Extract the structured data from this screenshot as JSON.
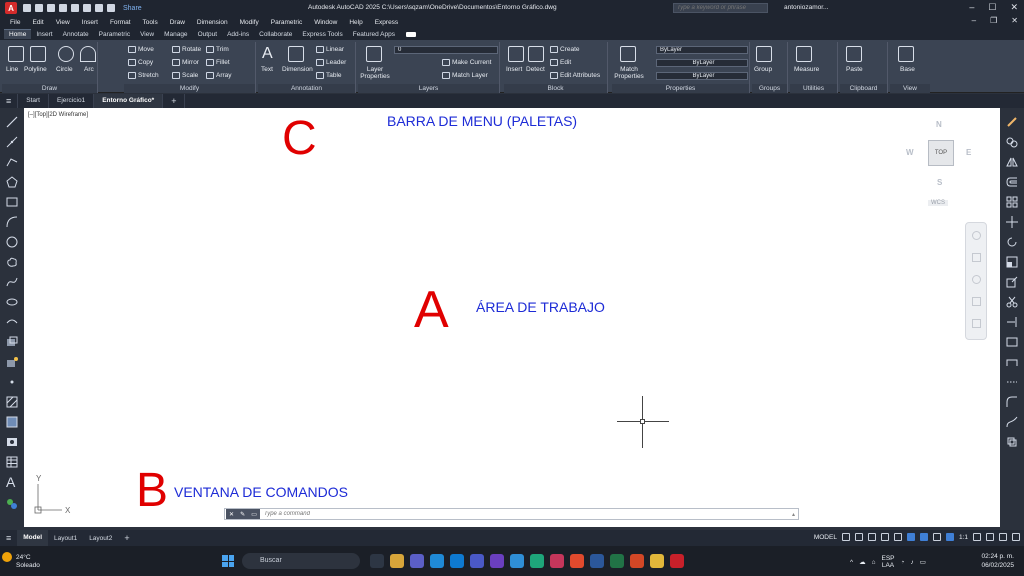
{
  "titlebar": {
    "app_logo": "A",
    "share_label": "Share",
    "title": "Autodesk AutoCAD 2025   C:\\Users\\sqzam\\OneDrive\\Documentos\\Entorno Gráfico.dwg",
    "search_placeholder": "Type a keyword or phrase",
    "user": "antoniozamor...",
    "window_controls": [
      "–",
      "☐",
      "✕"
    ]
  },
  "menubar": {
    "items": [
      "File",
      "Edit",
      "View",
      "Insert",
      "Format",
      "Tools",
      "Draw",
      "Dimension",
      "Modify",
      "Parametric",
      "Window",
      "Help",
      "Express"
    ]
  },
  "ribbon_tabs": {
    "items": [
      "Home",
      "Insert",
      "Annotate",
      "Parametric",
      "View",
      "Manage",
      "Output",
      "Add-ins",
      "Collaborate",
      "Express Tools",
      "Featured Apps"
    ],
    "active": "Home"
  },
  "ribbon": {
    "draw": {
      "title": "Draw",
      "line": "Line",
      "polyline": "Polyline",
      "circle": "Circle",
      "arc": "Arc"
    },
    "modify": {
      "title": "Modify",
      "move": "Move",
      "rotate": "Rotate",
      "trim": "Trim",
      "copy": "Copy",
      "mirror": "Mirror",
      "fillet": "Fillet",
      "stretch": "Stretch",
      "scale": "Scale",
      "array": "Array"
    },
    "annotation": {
      "title": "Annotation",
      "text": "Text",
      "dimension": "Dimension",
      "linear": "Linear",
      "leader": "Leader",
      "table": "Table"
    },
    "layers": {
      "title": "Layers",
      "layer_properties": "Layer Properties",
      "layer_value": "0",
      "make_current": "Make Current",
      "match_layer": "Match Layer"
    },
    "block": {
      "title": "Block",
      "insert": "Insert",
      "detect": "Detect",
      "create": "Create",
      "edit": "Edit",
      "edit_attributes": "Edit Attributes"
    },
    "properties": {
      "title": "Properties",
      "match_properties": "Match Properties",
      "color": "ByLayer",
      "linetype": "ByLayer",
      "lineweight": "ByLayer"
    },
    "groups": {
      "title": "Groups",
      "group": "Group"
    },
    "utilities": {
      "title": "Utilities",
      "measure": "Measure"
    },
    "clipboard": {
      "title": "Clipboard",
      "paste": "Paste"
    },
    "view": {
      "title": "View",
      "base": "Base"
    }
  },
  "file_tabs": {
    "items": [
      "Start",
      "Ejercicio1",
      "Entorno Gráfico*"
    ],
    "active": "Entorno Gráfico*"
  },
  "workarea": {
    "viewport_label": "[–][Top][2D Wireframe]",
    "letter_c": "C",
    "label_c": "BARRA DE MENU (PALETAS)",
    "letter_a": "A",
    "label_a": "ÁREA DE TRABAJO",
    "letter_b": "B",
    "label_b": "VENTANA DE COMANDOS",
    "ucs_x": "X",
    "ucs_y": "Y"
  },
  "viewcube": {
    "n": "N",
    "s": "S",
    "e": "E",
    "w": "W",
    "top": "TOP",
    "wcs": "WCS"
  },
  "command_line": {
    "placeholder": "Type a command"
  },
  "statusbar": {
    "layouts": [
      "Model",
      "Layout1",
      "Layout2"
    ],
    "active_layout": "Model",
    "model_label": "MODEL",
    "scale": "1:1"
  },
  "taskbar": {
    "weather_temp": "24°C",
    "weather_text": "Soleado",
    "search": "Buscar",
    "lang": "ESP",
    "lang2": "LAA",
    "time": "02:24 p. m.",
    "date": "06/02/2025"
  }
}
